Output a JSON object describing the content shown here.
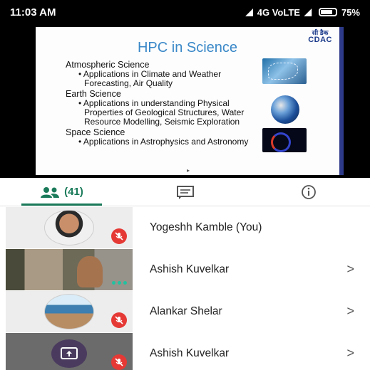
{
  "status": {
    "time": "11:03 AM",
    "network": "4G VoLTE",
    "battery": "75%"
  },
  "slide": {
    "logo_line1": "सी डैक",
    "logo_line2": "CDAC",
    "title": "HPC in Science",
    "sections": [
      {
        "heading": "Atmospheric Science",
        "bullet": "• Applications in Climate and Weather Forecasting, Air Quality"
      },
      {
        "heading": "Earth Science",
        "bullet": "• Applications in understanding Physical Properties of Geological Structures, Water Resource Modelling, Seismic Exploration"
      },
      {
        "heading": "Space Science",
        "bullet": "• Applications in Astrophysics and Astronomy"
      }
    ]
  },
  "tabs": {
    "people_count": "(41)",
    "people_icon": "people-icon",
    "chat_icon": "chat-icon",
    "info_icon": "info-icon",
    "accent_color": "#1a7a5a"
  },
  "participants": [
    {
      "name": "Yogeshh Kamble (You)",
      "muted": true,
      "chevron": ""
    },
    {
      "name": "Ashish Kuvelkar",
      "muted": false,
      "chevron": ">"
    },
    {
      "name": "Alankar Shelar",
      "muted": true,
      "chevron": ">"
    },
    {
      "name": "Ashish Kuvelkar",
      "muted": true,
      "chevron": ">"
    }
  ]
}
